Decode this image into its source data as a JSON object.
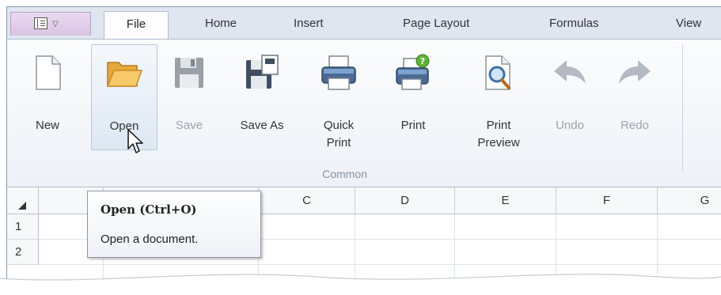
{
  "app_menu": {
    "icon": "app-menu-icon",
    "arrow": "▽"
  },
  "tabs": [
    {
      "label": "File",
      "active": true
    },
    {
      "label": "Home"
    },
    {
      "label": "Insert"
    },
    {
      "label": "Page Layout"
    },
    {
      "label": "Formulas"
    },
    {
      "label": "View"
    }
  ],
  "ribbon": {
    "buttons": [
      {
        "label": "New",
        "icon": "new-document-icon"
      },
      {
        "label": "Open",
        "icon": "open-folder-icon",
        "state": "hover"
      },
      {
        "label": "Save",
        "icon": "save-disk-icon",
        "state": "disabled"
      },
      {
        "label": "Save As",
        "icon": "save-as-icon"
      },
      {
        "label": "Quick\nPrint",
        "icon": "quick-print-icon"
      },
      {
        "label": "Print",
        "icon": "print-icon"
      },
      {
        "label": "Print\nPreview",
        "icon": "print-preview-icon"
      },
      {
        "label": "Undo",
        "icon": "undo-icon",
        "state": "disabled"
      },
      {
        "label": "Redo",
        "icon": "redo-icon",
        "state": "disabled"
      }
    ],
    "group_label": "Common"
  },
  "grid": {
    "columns": [
      "",
      "C",
      "D",
      "E",
      "F",
      "G"
    ],
    "rows": [
      "1",
      "2"
    ]
  },
  "tooltip": {
    "title": "Open (Ctrl+O)",
    "description": "Open a document."
  },
  "colors": {
    "ribbon_bg": "#f4f7fb",
    "app_menu": "#e3cfe9",
    "hover_border": "#b8c8dc",
    "disabled_text": "#9aa3ad"
  }
}
